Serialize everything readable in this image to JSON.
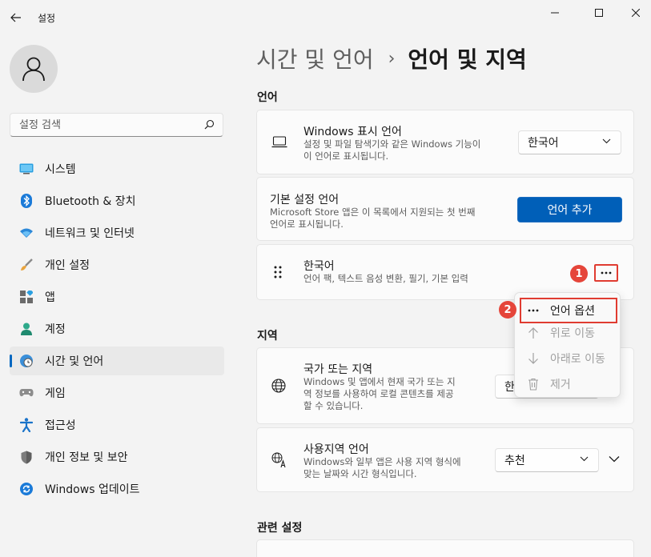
{
  "window": {
    "title": "설정"
  },
  "sidebar": {
    "search_placeholder": "설정 검색",
    "items": [
      {
        "label": "시스템",
        "icon": "system-icon"
      },
      {
        "label": "Bluetooth & 장치",
        "icon": "bluetooth-icon"
      },
      {
        "label": "네트워크 및 인터넷",
        "icon": "wifi-icon"
      },
      {
        "label": "개인 설정",
        "icon": "brush-icon"
      },
      {
        "label": "앱",
        "icon": "apps-icon"
      },
      {
        "label": "계정",
        "icon": "account-icon"
      },
      {
        "label": "시간 및 언어",
        "icon": "time-language-icon",
        "active": true
      },
      {
        "label": "게임",
        "icon": "gamepad-icon"
      },
      {
        "label": "접근성",
        "icon": "accessibility-icon"
      },
      {
        "label": "개인 정보 및 보안",
        "icon": "shield-icon"
      },
      {
        "label": "Windows 업데이트",
        "icon": "update-icon"
      }
    ]
  },
  "breadcrumb": {
    "parent": "시간 및 언어",
    "separator": "›",
    "current": "언어 및 지역"
  },
  "language_section": {
    "title": "언어",
    "display_language": {
      "title": "Windows 표시 언어",
      "desc_line1": "설정 및 파일 탐색기와 같은 Windows 기능이",
      "desc_line2": "이 언어로 표시됩니다.",
      "value": "한국어"
    },
    "preferred_languages": {
      "title": "기본 설정 언어",
      "desc_line1": "Microsoft Store 앱은 이 목록에서 지원되는 첫 번째",
      "desc_line2": "언어로 표시됩니다.",
      "button": "언어 추가"
    },
    "korean": {
      "title": "한국어",
      "desc": "언어 팩, 텍스트 음성 변환, 필기, 기본 입력"
    }
  },
  "context_menu": {
    "items": [
      {
        "label": "언어 옵션",
        "icon": "more-icon",
        "enabled": true
      },
      {
        "label": "위로 이동",
        "icon": "arrow-up-icon",
        "enabled": false
      },
      {
        "label": "아래로 이동",
        "icon": "arrow-down-icon",
        "enabled": false
      },
      {
        "label": "제거",
        "icon": "trash-icon",
        "enabled": false
      }
    ]
  },
  "region_section": {
    "title": "지역",
    "country": {
      "title": "국가 또는 지역",
      "desc_line1": "Windows 및 앱에서 현재 국가 또는 지",
      "desc_line2": "역 정보를 사용하여 로컬 콘텐츠를 제공",
      "desc_line3": "할 수 있습니다.",
      "value": "한"
    },
    "regional_format": {
      "title": "사용지역 언어",
      "desc_line1": "Windows와 일부 앱은 사용 지역 형식에",
      "desc_line2": "맞는 날짜와 시간 형식입니다.",
      "value": "추천"
    }
  },
  "related_section": {
    "title": "관련 설정"
  },
  "annotations": {
    "step1": "1",
    "step2": "2"
  },
  "colors": {
    "accent": "#0067c0",
    "primary_button": "#005fb8",
    "annotation_red": "#e03c31"
  }
}
